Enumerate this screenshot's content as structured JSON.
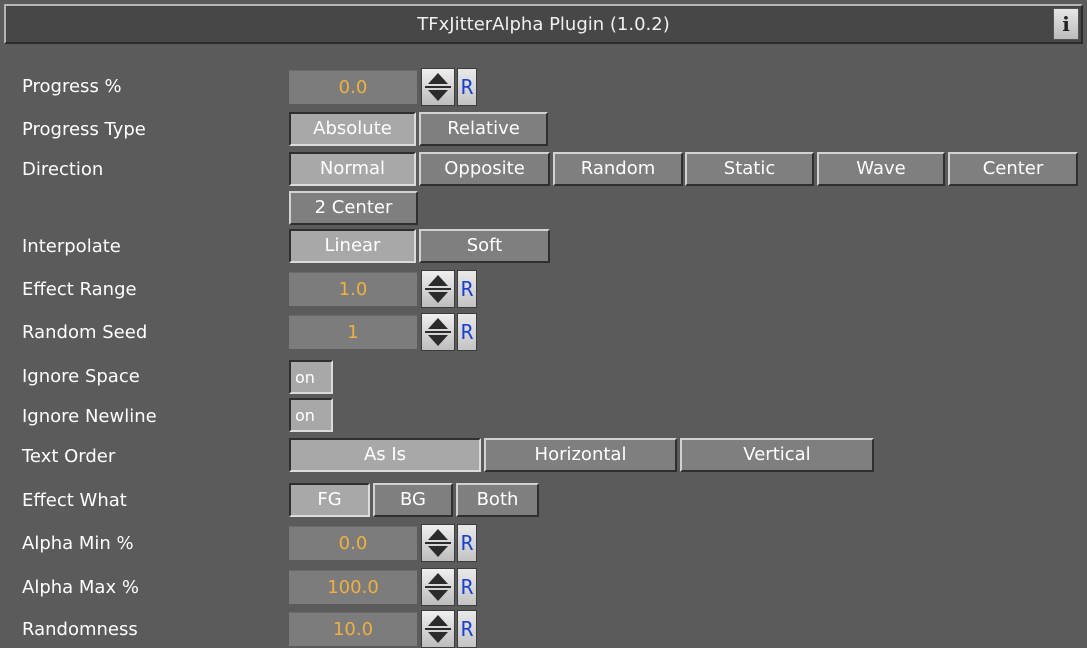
{
  "panel": {
    "title": "TFxJitterAlpha Plugin (1.0.2)",
    "info_label": "i"
  },
  "reset_label": "R",
  "progress": {
    "label": "Progress %",
    "value": "0.0"
  },
  "progress_type": {
    "label": "Progress Type",
    "options": [
      "Absolute",
      "Relative"
    ],
    "selected": "Absolute"
  },
  "direction": {
    "label": "Direction",
    "options": [
      "Normal",
      "Opposite",
      "Random",
      "Static",
      "Wave",
      "Center",
      "2 Center"
    ],
    "selected": "Normal"
  },
  "interpolate": {
    "label": "Interpolate",
    "options": [
      "Linear",
      "Soft"
    ],
    "selected": "Linear"
  },
  "effect_range": {
    "label": "Effect Range",
    "value": "1.0"
  },
  "random_seed": {
    "label": "Random Seed",
    "value": "1"
  },
  "ignore_space": {
    "label": "Ignore Space",
    "toggle": "on"
  },
  "ignore_newline": {
    "label": "Ignore Newline",
    "toggle": "on"
  },
  "text_order": {
    "label": "Text Order",
    "options": [
      "As Is",
      "Horizontal",
      "Vertical"
    ],
    "selected": "As Is"
  },
  "effect_what": {
    "label": "Effect What",
    "options": [
      "FG",
      "BG",
      "Both"
    ],
    "selected": "FG"
  },
  "alpha_min": {
    "label": "Alpha Min %",
    "value": "0.0"
  },
  "alpha_max": {
    "label": "Alpha Max %",
    "value": "100.0"
  },
  "randomness": {
    "label": "Randomness",
    "value": "10.0"
  },
  "colors": {
    "panel_bg": "#5b5b5b",
    "value_text": "#f0b040",
    "reset_text": "#1b40d0"
  }
}
